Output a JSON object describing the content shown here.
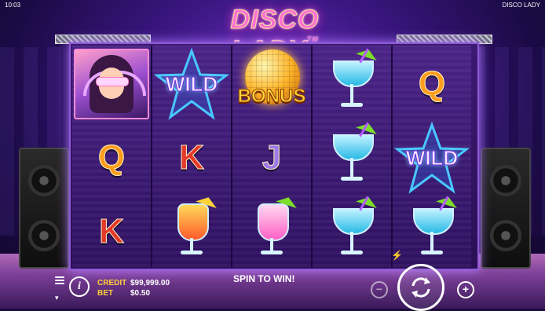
{
  "status_bar": {
    "time": "10:03",
    "game_name": "DISCO LADY"
  },
  "logo": {
    "title": "DISCO LADY",
    "tm": "TM"
  },
  "reels": [
    [
      {
        "symbol": "disco-lady-portrait-icon"
      },
      {
        "symbol": "Q"
      },
      {
        "symbol": "K"
      }
    ],
    [
      {
        "symbol": "WILD"
      },
      {
        "symbol": "K"
      },
      {
        "symbol": "orange-cocktail-icon"
      }
    ],
    [
      {
        "symbol": "BONUS"
      },
      {
        "symbol": "J"
      },
      {
        "symbol": "pink-cocktail-icon"
      }
    ],
    [
      {
        "symbol": "blue-cocktail-icon"
      },
      {
        "symbol": "blue-cocktail-icon"
      },
      {
        "symbol": "blue-cocktail-icon"
      }
    ],
    [
      {
        "symbol": "Q"
      },
      {
        "symbol": "WILD"
      },
      {
        "symbol": "blue-cocktail-icon"
      }
    ]
  ],
  "symbols": {
    "wild": "WILD",
    "bonus": "BONUS"
  },
  "hud": {
    "credit_label": "CREDIT",
    "credit_value": "$99,999.00",
    "bet_label": "BET",
    "bet_value": "$0.50",
    "message": "SPIN TO WIN!",
    "minus": "−",
    "plus": "+",
    "info": "i"
  },
  "colors": {
    "accent_gold": "#ffcf3a",
    "frame": "#8f5ad6",
    "wild_text": "#f6e8ff",
    "bonus_text": "#ffd23a"
  }
}
